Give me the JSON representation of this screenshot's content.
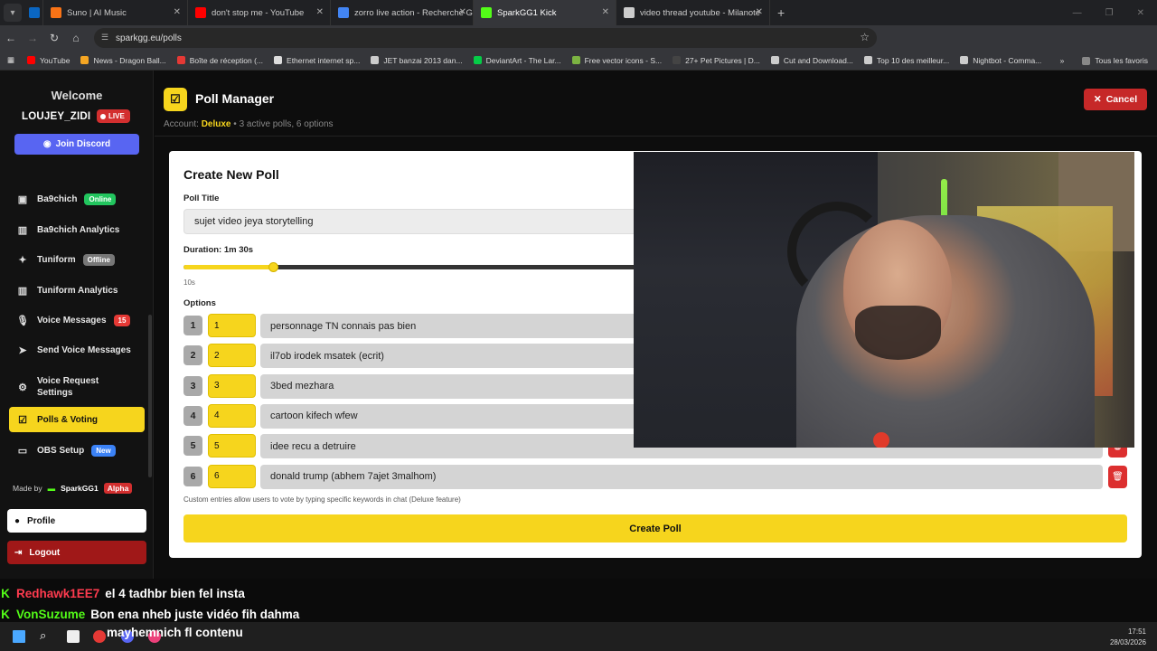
{
  "browser": {
    "tabs": [
      {
        "label": "Suno | AI Music",
        "fav_color": "#f97316"
      },
      {
        "label": "don't stop me - YouTube",
        "fav_color": "#ff0000"
      },
      {
        "label": "zorro live action - Recherche Go",
        "fav_color": "#4285f4"
      },
      {
        "label": "SparkGG1 Kick",
        "fav_color": "#53fc18"
      },
      {
        "label": "video thread youtube - Milanote",
        "fav_color": "#cccccc"
      }
    ],
    "url": "sparkgg.eu/polls",
    "bookmarks": [
      "YouTube",
      "News - Dragon Ball...",
      "Boîte de réception (...",
      "Ethernet internet sp...",
      "JET banzai 2013 dan...",
      "DeviantArt - The Lar...",
      "Free vector icons - S...",
      "27+ Pet Pictures | D...",
      "Cut and Download...",
      "Top 10 des meilleur...",
      "Nightbot - Comma..."
    ],
    "bookmarks_right": "Tous les favoris"
  },
  "sidebar": {
    "welcome": "Welcome",
    "username": "LOUJEY_ZIDI",
    "live_badge": "LIVE",
    "discord_button": "Join Discord",
    "items": [
      {
        "label": "Ba9chich",
        "badge": "Online",
        "icon": "chip-icon"
      },
      {
        "label": "Ba9chich Analytics",
        "badge": "",
        "icon": "chart-icon"
      },
      {
        "label": "Tuniform",
        "badge": "Offline",
        "icon": "puzzle-icon"
      },
      {
        "label": "Tuniform Analytics",
        "badge": "",
        "icon": "chart-icon"
      },
      {
        "label": "Voice Messages",
        "badge": "15",
        "icon": "mic-icon"
      },
      {
        "label": "Send Voice Messages",
        "badge": "",
        "icon": "send-icon"
      },
      {
        "label": "Voice Request Settings",
        "badge": "",
        "icon": "gear-icon"
      },
      {
        "label": "Polls & Voting",
        "badge": "",
        "icon": "poll-icon"
      },
      {
        "label": "OBS Setup",
        "badge": "New",
        "icon": "monitor-icon"
      }
    ],
    "made_by": "Made by",
    "made_by_name": "SparkGG1",
    "alpha_badge": "Alpha",
    "profile": "Profile",
    "logout": "Logout"
  },
  "header": {
    "title": "Poll Manager",
    "account_label": "Account:",
    "account_plan": "Deluxe",
    "account_stats": "3 active polls, 6 options",
    "cancel_button": "Cancel"
  },
  "form": {
    "heading": "Create New Poll",
    "poll_title_label": "Poll Title",
    "poll_title_value": "sujet video jeya storytelling",
    "duration_label": "Duration: 1m 30s",
    "duration_fraction": 0.095,
    "duration_min_label": "10s",
    "options_label": "Options",
    "options": [
      {
        "num": "1",
        "key": "1",
        "text": "personnage TN connais pas bien"
      },
      {
        "num": "2",
        "key": "2",
        "text": "il7ob irodek msatek (ecrit)"
      },
      {
        "num": "3",
        "key": "3",
        "text": "3bed mezhara"
      },
      {
        "num": "4",
        "key": "4",
        "text": "cartoon kifech wfew"
      },
      {
        "num": "5",
        "key": "5",
        "text": "idee recu a detruire"
      },
      {
        "num": "6",
        "key": "6",
        "text": "donald trump (abhem 7ajet 3malhom)"
      }
    ],
    "note": "Custom entries allow users to vote by typing specific keywords in chat (Deluxe feature)",
    "create_button": "Create Poll"
  },
  "chat": [
    {
      "name": "Redhawk1EE7",
      "message": "el 4 tadhbr bien fel insta"
    },
    {
      "name": "VonSuzume",
      "message": "Bon ena nheb juste vidéo fih dahma"
    },
    {
      "name": "",
      "message": "mayhemnich fl contenu"
    }
  ],
  "taskbar": {
    "time": "17:51",
    "date": "28/03/2026"
  },
  "colors": {
    "accent": "#f6d51d",
    "danger": "#c62828",
    "discord": "#5865f2",
    "kick": "#53fc18"
  }
}
